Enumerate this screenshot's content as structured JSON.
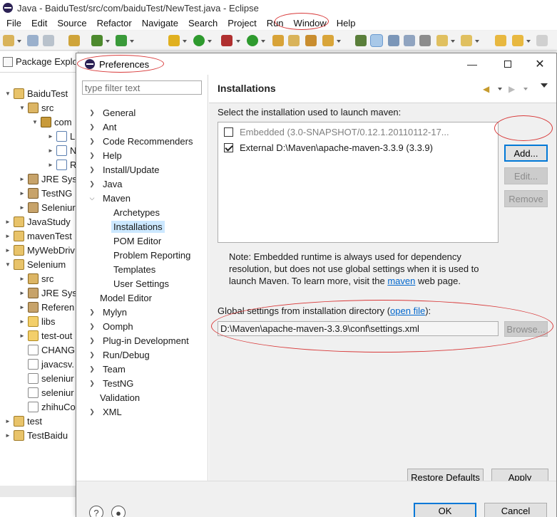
{
  "window": {
    "title": "Java - BaiduTest/src/com/baiduTest/NewTest.java - Eclipse"
  },
  "menubar": {
    "items": [
      {
        "label": "File"
      },
      {
        "label": "Edit"
      },
      {
        "label": "Source"
      },
      {
        "label": "Refactor"
      },
      {
        "label": "Navigate"
      },
      {
        "label": "Search"
      },
      {
        "label": "Project"
      },
      {
        "label": "Run"
      },
      {
        "label": "Window"
      },
      {
        "label": "Help"
      }
    ]
  },
  "package_explorer": {
    "title": "Package Explo",
    "rows": [
      {
        "label": "BaiduTest",
        "icon": "project-icon"
      },
      {
        "label": "src",
        "icon": "source-folder-icon"
      },
      {
        "label": "com",
        "icon": "package-icon"
      },
      {
        "label": "L",
        "icon": "java-file-icon"
      },
      {
        "label": "N",
        "icon": "java-file-icon"
      },
      {
        "label": "R",
        "icon": "java-file-icon"
      },
      {
        "label": "JRE Syst",
        "icon": "library-icon"
      },
      {
        "label": "TestNG",
        "icon": "library-icon"
      },
      {
        "label": "Seleniur",
        "icon": "library-icon"
      },
      {
        "label": "JavaStudy",
        "icon": "project-icon"
      },
      {
        "label": "mavenTest",
        "icon": "project-icon"
      },
      {
        "label": "MyWebDriv",
        "icon": "project-icon"
      },
      {
        "label": "Selenium",
        "icon": "project-icon"
      },
      {
        "label": "src",
        "icon": "source-folder-icon"
      },
      {
        "label": "JRE Syst",
        "icon": "library-icon"
      },
      {
        "label": "Referen",
        "icon": "library-icon"
      },
      {
        "label": "libs",
        "icon": "folder-icon"
      },
      {
        "label": "test-out",
        "icon": "folder-icon"
      },
      {
        "label": "CHANG",
        "icon": "file-icon"
      },
      {
        "label": "javacsv.",
        "icon": "jar-icon"
      },
      {
        "label": "seleniur",
        "icon": "jar-icon"
      },
      {
        "label": "seleniur",
        "icon": "jar-icon"
      },
      {
        "label": "zhihuCo",
        "icon": "file-icon"
      },
      {
        "label": "test",
        "icon": "project-icon"
      },
      {
        "label": "TestBaidu",
        "icon": "project-icon"
      }
    ]
  },
  "dialog": {
    "title": "Preferences",
    "filter_placeholder": "type filter text",
    "tree": [
      {
        "label": "General",
        "expandable": true
      },
      {
        "label": "Ant",
        "expandable": true
      },
      {
        "label": "Code Recommenders",
        "expandable": true
      },
      {
        "label": "Help",
        "expandable": true
      },
      {
        "label": "Install/Update",
        "expandable": true
      },
      {
        "label": "Java",
        "expandable": true
      },
      {
        "label": "Maven",
        "expandable": true,
        "expanded": true
      },
      {
        "label": "Archetypes",
        "child": true
      },
      {
        "label": "Installations",
        "child": true,
        "selected": true
      },
      {
        "label": "POM Editor",
        "child": true
      },
      {
        "label": "Problem Reporting",
        "child": true
      },
      {
        "label": "Templates",
        "child": true
      },
      {
        "label": "User Settings",
        "child": true
      },
      {
        "label": "Model Editor",
        "expandable": false
      },
      {
        "label": "Mylyn",
        "expandable": true
      },
      {
        "label": "Oomph",
        "expandable": true
      },
      {
        "label": "Plug-in Development",
        "expandable": true
      },
      {
        "label": "Run/Debug",
        "expandable": true
      },
      {
        "label": "Team",
        "expandable": true
      },
      {
        "label": "TestNG",
        "expandable": true
      },
      {
        "label": "Validation",
        "expandable": false
      },
      {
        "label": "XML",
        "expandable": true
      }
    ],
    "page": {
      "title": "Installations",
      "select_label": "Select the installation used to launch maven:",
      "installations": [
        {
          "label": "Embedded (3.0-SNAPSHOT/0.12.1.20110112-17...",
          "checked": false,
          "dimmed": true
        },
        {
          "label": "External D:\\Maven\\apache-maven-3.3.9 (3.3.9)",
          "checked": true,
          "dimmed": false
        }
      ],
      "buttons": {
        "add": "Add...",
        "edit": "Edit...",
        "remove": "Remove"
      },
      "note_part1": "Note: Embedded runtime is always used for dependency resolution, but does not use global settings when it is used to launch Maven. To learn more, visit the ",
      "note_link": "maven",
      "note_part2": " web page.",
      "global_label_part1": "Global settings from installation directory (",
      "global_link": "open file",
      "global_label_part2": "):",
      "global_path": "D:\\Maven\\apache-maven-3.3.9\\conf\\settings.xml",
      "browse": "Browse...",
      "restore": "Restore Defaults",
      "apply": "Apply"
    },
    "ok": "OK",
    "cancel": "Cancel"
  },
  "colors": {
    "selection": "#cce8ff",
    "link": "#0066cc",
    "annotation": "#d83a3a"
  }
}
